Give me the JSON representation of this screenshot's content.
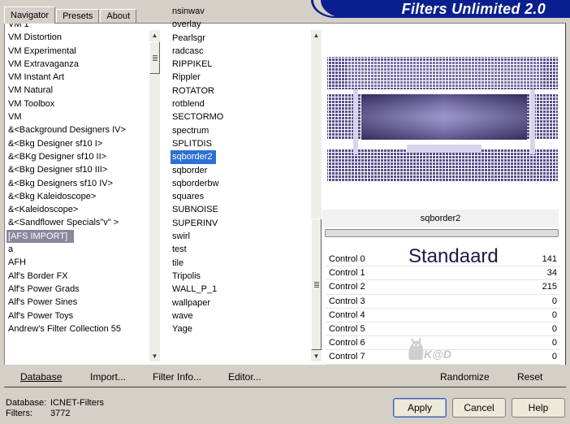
{
  "banner": {
    "title": "Filters Unlimited 2.0"
  },
  "tabs": [
    {
      "label": "Navigator",
      "active": true
    },
    {
      "label": "Presets",
      "active": false
    },
    {
      "label": "About",
      "active": false
    }
  ],
  "categories": [
    "VM 1",
    "VM Distortion",
    "VM Experimental",
    "VM Extravaganza",
    "VM Instant Art",
    "VM Natural",
    "VM Toolbox",
    "VM",
    "&<Background Designers IV>",
    "&<Bkg Designer sf10 I>",
    "&<BKg Designer sf10 II>",
    "&<Bkg Designer sf10 III>",
    "&<Bkg Designers sf10 IV>",
    "&<Bkg Kaleidoscope>",
    "&<Kaleidoscope>",
    "&<Sandflower Specials\"v\" >",
    "[AFS IMPORT]",
    "a",
    "AFH",
    "Alf's Border FX",
    "Alf's Power Grads",
    "Alf's Power Sines",
    "Alf's Power Toys",
    "Andrew's Filter Collection 55"
  ],
  "selected_category": "[AFS IMPORT]",
  "filters": [
    "nsinwav",
    "overlay",
    "Pearlsgr",
    "radcasc",
    "RIPPIKEL",
    "Rippler",
    "ROTATOR",
    "rotblend",
    "SECTORMO",
    "spectrum",
    "SPLITDIS",
    "sqborder2",
    "sqborder",
    "sqborderbw",
    "squares",
    "SUBNOISE",
    "SUPERINV",
    "swirl",
    "test",
    "tile",
    "Tripolis",
    "WALL_P_1",
    "wallpaper",
    "wave",
    "Yage"
  ],
  "selected_filter": "sqborder2",
  "preview": {
    "filter_name": "sqborder2",
    "preset_name": "Standaard",
    "watermark": "K@D"
  },
  "controls": [
    {
      "label": "Control 0",
      "value": "141"
    },
    {
      "label": "Control 1",
      "value": "34"
    },
    {
      "label": "Control 2",
      "value": "215"
    },
    {
      "label": "Control 3",
      "value": "0"
    },
    {
      "label": "Control 4",
      "value": "0"
    },
    {
      "label": "Control 5",
      "value": "0"
    },
    {
      "label": "Control 6",
      "value": "0"
    },
    {
      "label": "Control 7",
      "value": "0"
    }
  ],
  "links": {
    "database": "Database",
    "import": "Import...",
    "filter_info": "Filter Info...",
    "editor": "Editor...",
    "randomize": "Randomize",
    "reset": "Reset"
  },
  "footer": {
    "database_label": "Database:",
    "database_value": "ICNET-Filters",
    "filters_label": "Filters:",
    "filters_value": "3772"
  },
  "buttons": {
    "apply": "Apply",
    "cancel": "Cancel",
    "help": "Help"
  },
  "colors": {
    "banner": "#0a1f8f",
    "selection_blue": "#2e6fd6",
    "selection_gray": "#8b869b",
    "preview_purple": "#5a4f8c"
  }
}
